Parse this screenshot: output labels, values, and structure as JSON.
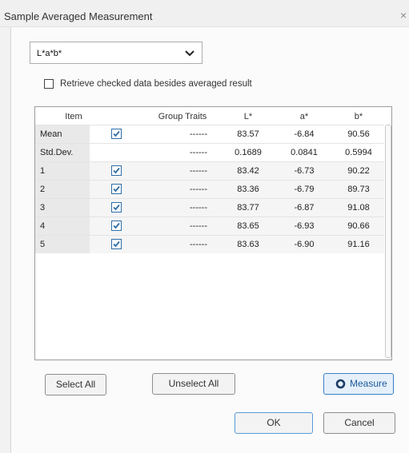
{
  "window": {
    "title": "Sample Averaged Measurement",
    "close_glyph": "×"
  },
  "select": {
    "value": "L*a*b*"
  },
  "checkbox": {
    "label": "Retrieve checked data besides averaged result",
    "checked": false
  },
  "table": {
    "headers": [
      "Item",
      "Group Traits",
      "L*",
      "a*",
      "b*"
    ],
    "rows": [
      {
        "item": "Mean",
        "checked": true,
        "traits": "------",
        "L": "83.57",
        "a": "-6.84",
        "b": "90.56"
      },
      {
        "item": "Std.Dev.",
        "checked": false,
        "traits": "------",
        "L": "0.1689",
        "a": "0.0841",
        "b": "0.5994"
      },
      {
        "item": "1",
        "checked": true,
        "traits": "------",
        "L": "83.42",
        "a": "-6.73",
        "b": "90.22"
      },
      {
        "item": "2",
        "checked": true,
        "traits": "------",
        "L": "83.36",
        "a": "-6.79",
        "b": "89.73"
      },
      {
        "item": "3",
        "checked": true,
        "traits": "------",
        "L": "83.77",
        "a": "-6.87",
        "b": "91.08"
      },
      {
        "item": "4",
        "checked": true,
        "traits": "------",
        "L": "83.65",
        "a": "-6.93",
        "b": "90.66"
      },
      {
        "item": "5",
        "checked": true,
        "traits": "------",
        "L": "83.63",
        "a": "-6.90",
        "b": "91.16"
      }
    ]
  },
  "buttons": {
    "select_all": "Select All",
    "unselect_all": "Unselect All",
    "measure": "Measure",
    "ok": "OK",
    "cancel": "Cancel"
  },
  "colors": {
    "accent": "#3a7fc4",
    "check": "#2f6da6"
  },
  "icons": {
    "checkmark": "checkmark-icon",
    "measure": "measure-icon",
    "chevron": "chevron-down-icon",
    "close": "close-icon"
  }
}
